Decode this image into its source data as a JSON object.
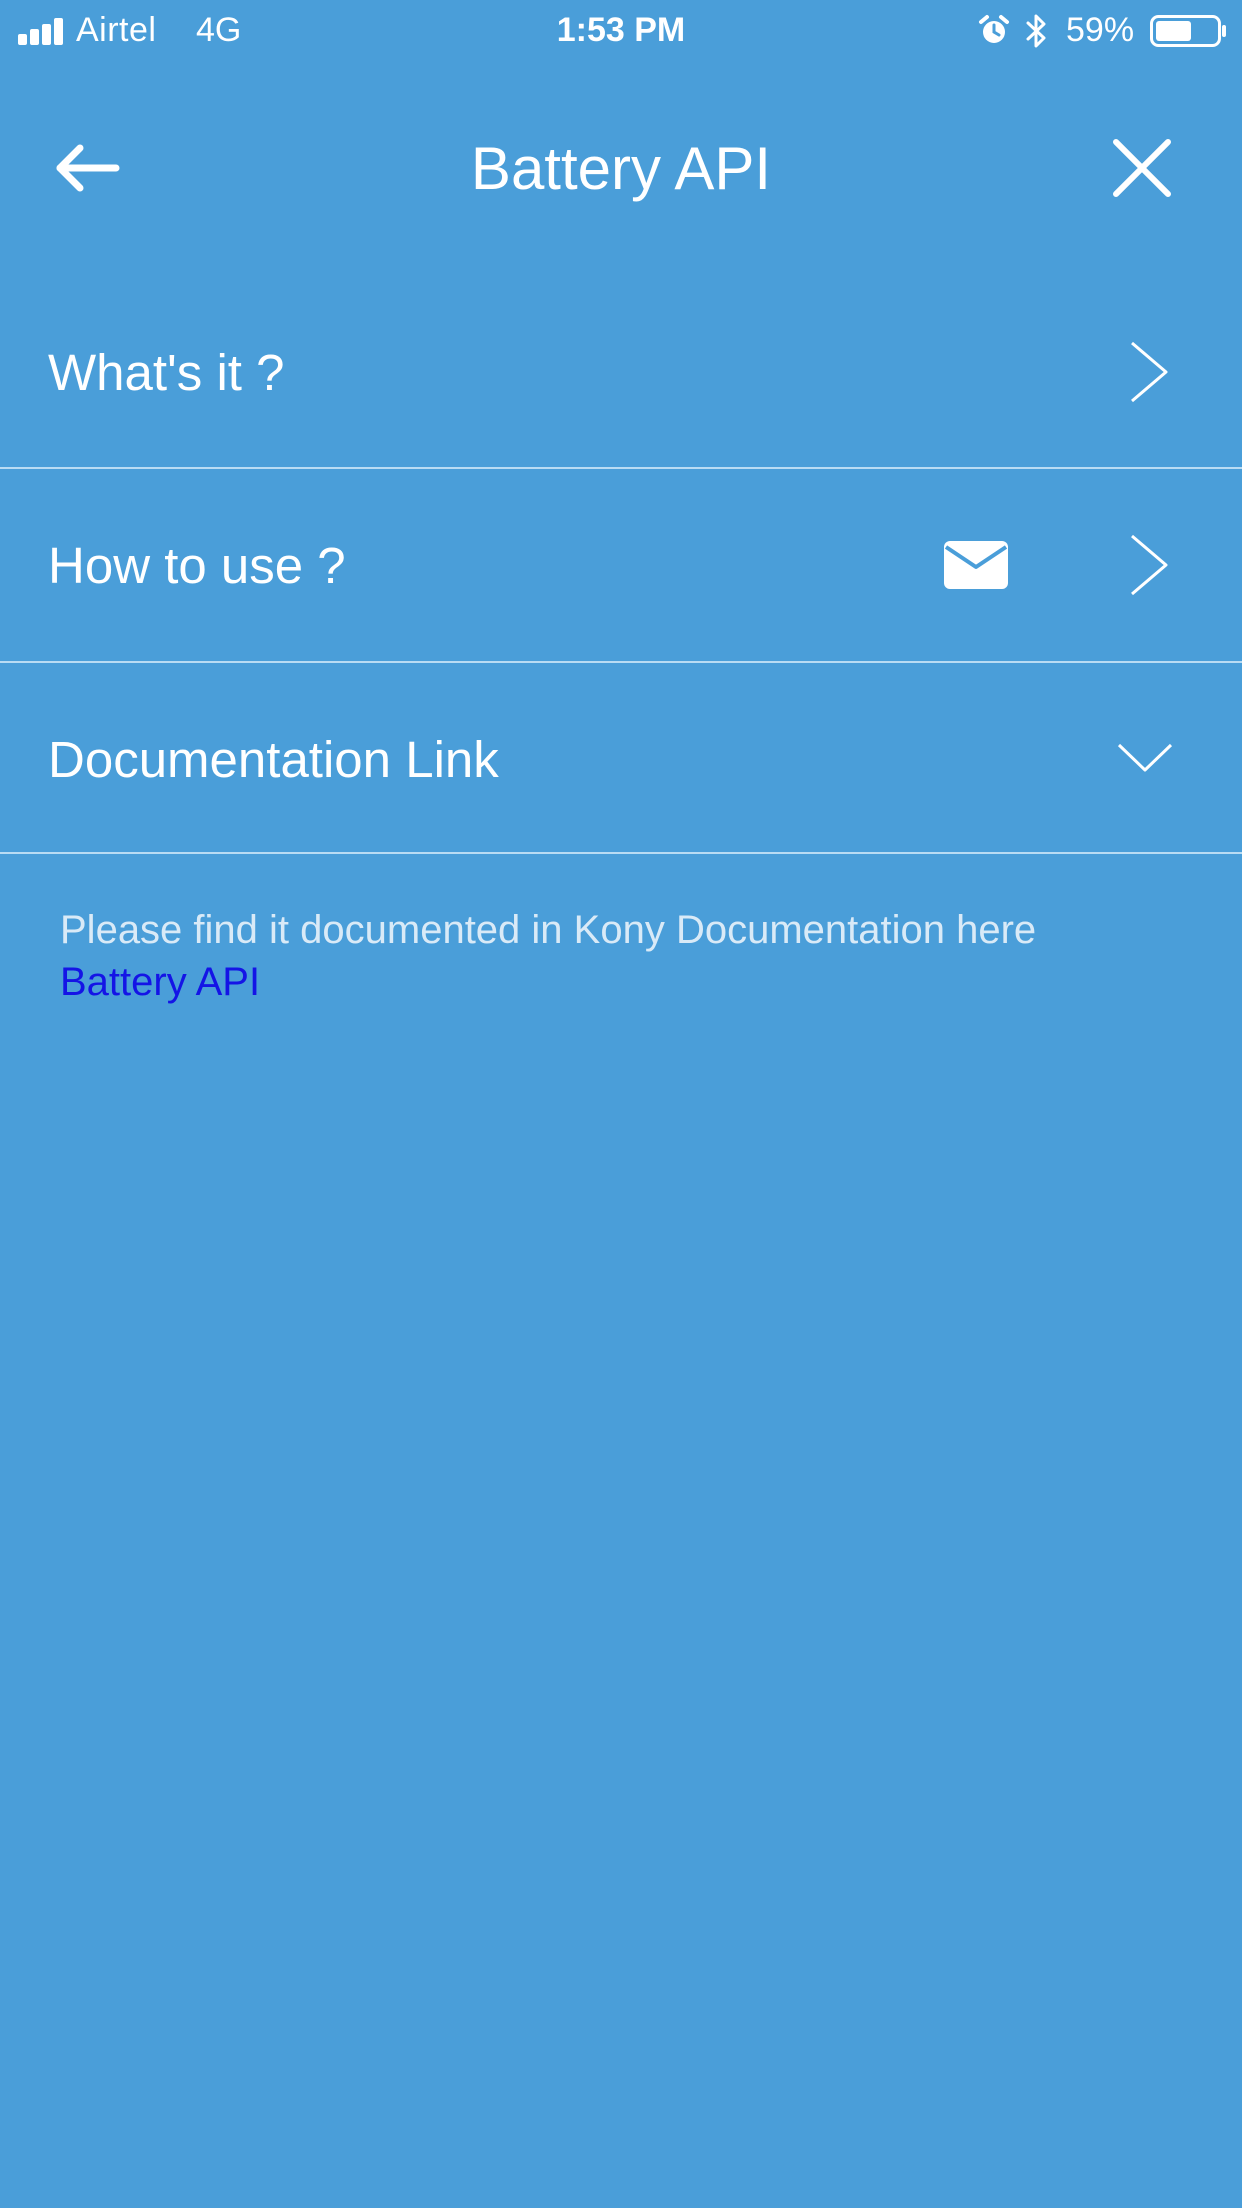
{
  "status_bar": {
    "carrier": "Airtel",
    "network": "4G",
    "time": "1:53 PM",
    "battery_percent": "59%",
    "battery_level": 0.59,
    "signal_bars": 4,
    "icons": [
      "signal-icon",
      "alarm-icon",
      "bluetooth-icon",
      "battery-icon"
    ]
  },
  "header": {
    "title": "Battery API",
    "back_icon": "arrow-left-icon",
    "close_icon": "close-icon"
  },
  "rows": [
    {
      "label": "What's it ?",
      "trailing_icon": "chevron-right-icon"
    },
    {
      "label": "How to use ?",
      "extra_icon": "mail-icon",
      "trailing_icon": "chevron-right-icon"
    },
    {
      "label": "Documentation Link",
      "trailing_icon": "chevron-down-icon",
      "expanded": true
    }
  ],
  "documentation": {
    "text": "Please find it documented in Kony Documentation here",
    "link_text": "Battery API"
  },
  "colors": {
    "background": "#4a9ed9",
    "divider": "#b9dcf4",
    "text": "#ffffff",
    "doc_text": "#d9eaf7",
    "link": "#1414e6"
  }
}
